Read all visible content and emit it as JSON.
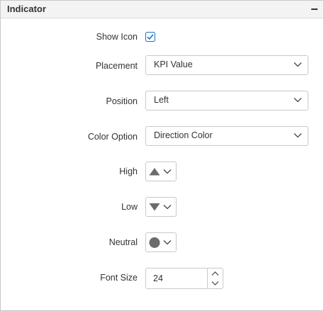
{
  "panel": {
    "title": "Indicator",
    "collapse_icon": "minus-icon"
  },
  "show_icon": {
    "label": "Show Icon",
    "checked": true
  },
  "placement": {
    "label": "Placement",
    "value": "KPI Value"
  },
  "position": {
    "label": "Position",
    "value": "Left"
  },
  "color_option": {
    "label": "Color Option",
    "value": "Direction Color"
  },
  "high": {
    "label": "High",
    "icon": "triangle-up-icon"
  },
  "low": {
    "label": "Low",
    "icon": "triangle-down-icon"
  },
  "neutral": {
    "label": "Neutral",
    "icon": "circle-icon"
  },
  "font_size": {
    "label": "Font Size",
    "value": "24"
  },
  "colors": {
    "accent": "#1a73c8",
    "icon_gray": "#6b6b6b"
  }
}
